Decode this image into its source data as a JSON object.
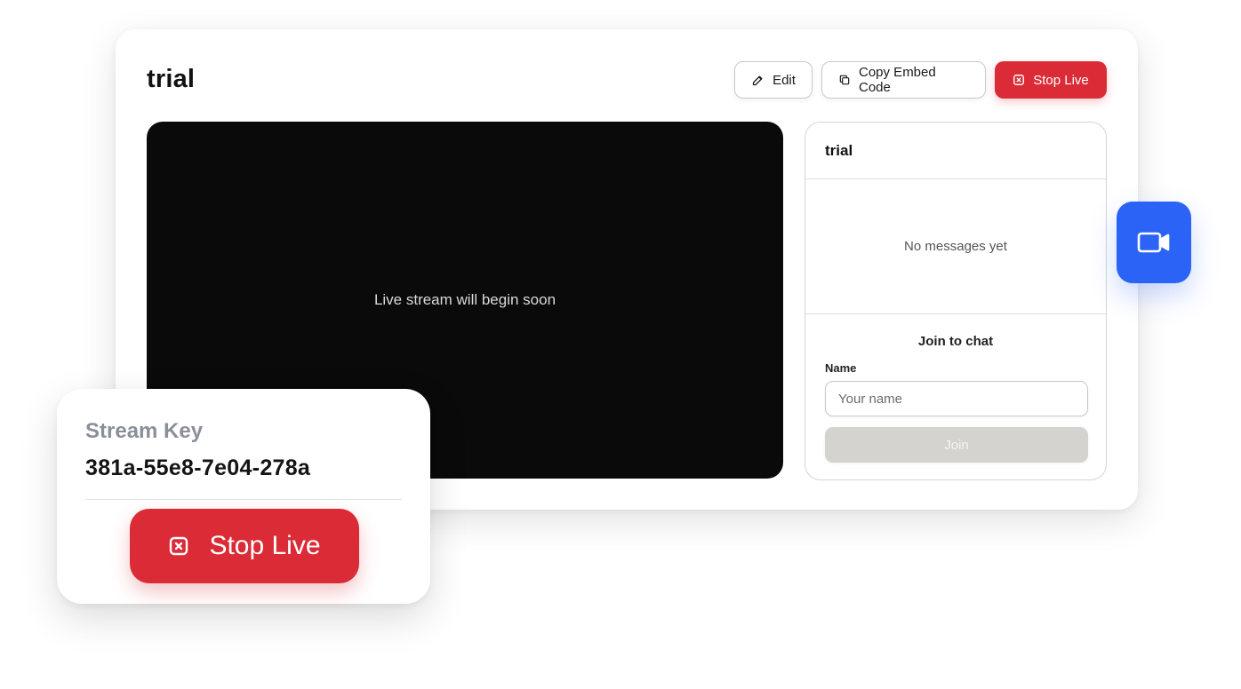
{
  "header": {
    "title": "trial"
  },
  "toolbar": {
    "edit_label": "Edit",
    "copy_label": "Copy Embed Code",
    "stop_label": "Stop Live"
  },
  "video": {
    "placeholder": "Live stream will begin soon"
  },
  "chat": {
    "title": "trial",
    "empty_message": "No messages yet",
    "join_title": "Join to chat",
    "name_label": "Name",
    "name_placeholder": "Your name",
    "join_label": "Join"
  },
  "stream_key_card": {
    "label": "Stream Key",
    "value": "381a-55e8-7e04-278a",
    "stop_label": "Stop Live"
  },
  "icons": {
    "edit": "pencil-icon",
    "copy": "copy-icon",
    "stop": "stop-live-icon",
    "camera": "video-camera-icon"
  },
  "colors": {
    "accent_red": "#db2b36",
    "accent_blue": "#2b63f6",
    "video_bg": "#0a0a0a",
    "join_disabled": "#d4d3cf"
  }
}
